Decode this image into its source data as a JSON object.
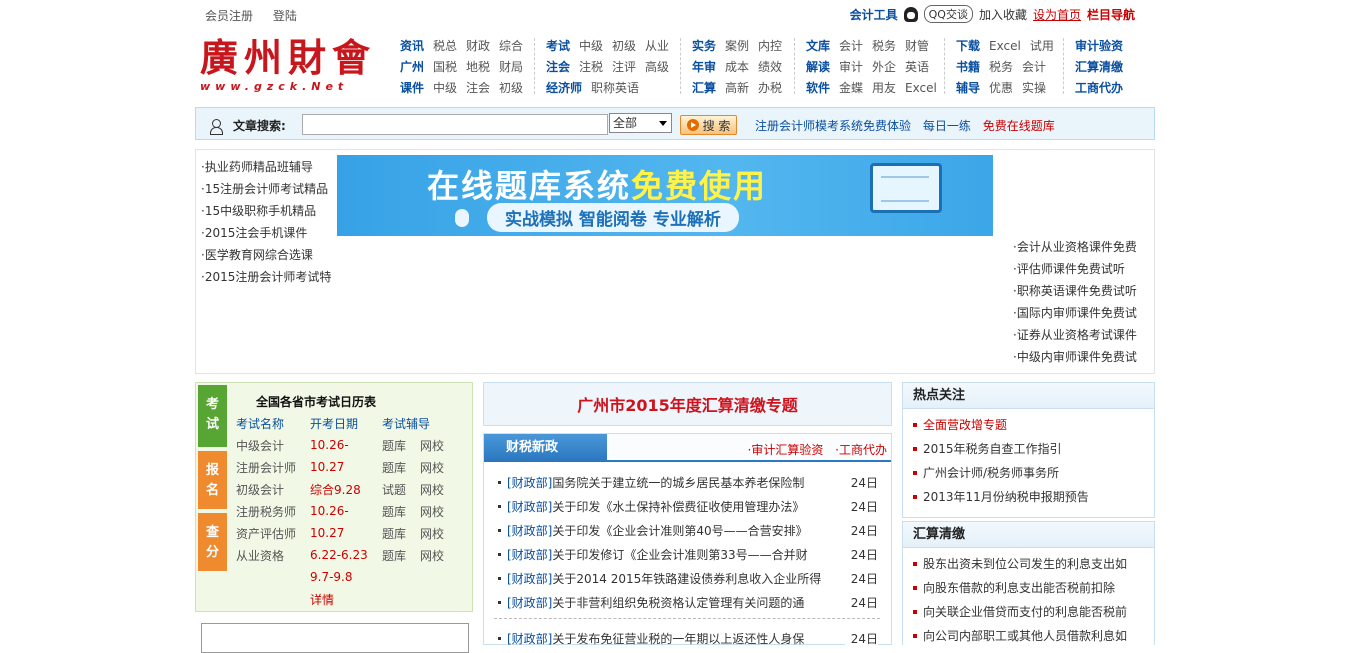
{
  "topbar": {
    "register": "会员注册",
    "login": "登陆",
    "tools": "会计工具",
    "qq": "QQ交谈",
    "favorite": "加入收藏",
    "set_home": "设为首页",
    "nav": "栏目导航"
  },
  "logo": {
    "cn": "廣州財會",
    "en": "www.gzck.Net"
  },
  "nav_groups": [
    {
      "rows": [
        [
          "资讯",
          "税总",
          "财政",
          "综合"
        ],
        [
          "广州",
          "国税",
          "地税",
          "财局"
        ],
        [
          "课件",
          "中级",
          "注会",
          "初级"
        ]
      ]
    },
    {
      "rows": [
        [
          "考试",
          "中级",
          "初级",
          "从业"
        ],
        [
          "注会",
          "注税",
          "注评",
          "高级"
        ],
        [
          "经济师",
          "职称英语"
        ]
      ]
    },
    {
      "rows": [
        [
          "实务",
          "案例",
          "内控"
        ],
        [
          "年审",
          "成本",
          "绩效"
        ],
        [
          "汇算",
          "高新",
          "办税"
        ]
      ]
    },
    {
      "rows": [
        [
          "文库",
          "会计",
          "税务",
          "财管"
        ],
        [
          "解读",
          "审计",
          "外企",
          "英语"
        ],
        [
          "软件",
          "金蝶",
          "用友",
          "Excel"
        ]
      ]
    },
    {
      "rows": [
        [
          "下载",
          "Excel",
          "试用"
        ],
        [
          "书籍",
          "税务",
          "会计"
        ],
        [
          "辅导",
          "优惠",
          "实操"
        ]
      ]
    },
    {
      "rows": [
        [
          "审计验资"
        ],
        [
          "汇算清缴"
        ],
        [
          "工商代办"
        ]
      ]
    }
  ],
  "search": {
    "label": "文章搜索:",
    "placeholder": "",
    "select_value": "全部",
    "button": "搜 索",
    "links": [
      "注册会计师模考系统免费体验",
      "每日一练",
      "免费在线题库"
    ]
  },
  "promo_left": [
    "·执业药师精品班辅导",
    "·15注册会计师考试精品",
    "·15中级职称手机精品",
    "·2015注会手机课件",
    "·医学教育网综合选课",
    "·2015注册会计师考试特"
  ],
  "banner": {
    "title_a": "在线题库系统",
    "title_b": "免费使用",
    "subtitle": "实战模拟 智能阅卷 专业解析",
    "screen_label": "模拟考试"
  },
  "promo_right": [
    "·会计从业资格课件免费",
    "·评估师课件免费试听",
    "·职称英语课件免费试听",
    "·国际内审师课件免费试",
    "·证券从业资格考试课件",
    "·中级内审师课件免费试"
  ],
  "calendar": {
    "tabs": [
      "考试",
      "报名",
      "查分"
    ],
    "title": "全国各省市考试日历表",
    "headers": [
      "考试名称",
      "开考日期",
      "考试辅导"
    ],
    "rows": [
      [
        "中级会计",
        "10.26-",
        "题库",
        "网校"
      ],
      [
        "注册会计师",
        "10.27",
        "题库",
        "网校"
      ],
      [
        "初级会计",
        "综合9.28",
        "试题",
        "网校"
      ],
      [
        "注册税务师",
        "10.26-",
        "题库",
        "网校"
      ],
      [
        "资产评估师",
        "10.27",
        "题库",
        "网校"
      ],
      [
        "从业资格",
        "6.22-6.23",
        "题库",
        "网校"
      ],
      [
        "",
        "9.7-9.8",
        "",
        ""
      ],
      [
        "",
        "详情",
        "",
        ""
      ]
    ]
  },
  "special_topic": "广州市2015年度汇算清缴专题",
  "news": {
    "tab": "财税新政",
    "tab_links": [
      "·审计汇算验资",
      "·工商代办"
    ],
    "items": [
      {
        "src": "[财政部]",
        "title": "国务院关于建立统一的城乡居民基本养老保险制",
        "day": "24日"
      },
      {
        "src": "[财政部]",
        "title": "关于印发《水土保持补偿费征收使用管理办法》",
        "day": "24日"
      },
      {
        "src": "[财政部]",
        "title": "关于印发《企业会计准则第40号——合营安排》",
        "day": "24日"
      },
      {
        "src": "[财政部]",
        "title": "关于印发修订《企业会计准则第33号——合并财",
        "day": "24日"
      },
      {
        "src": "[财政部]",
        "title": "关于2014 2015年铁路建设债券利息收入企业所得",
        "day": "24日"
      },
      {
        "src": "[财政部]",
        "title": "关于非营利组织免税资格认定管理有关问题的通",
        "day": "24日"
      },
      {
        "src": "[财政部]",
        "title": "关于发布免征营业税的一年期以上返还性人身保",
        "day": "24日"
      }
    ]
  },
  "hot": {
    "title": "热点关注",
    "items": [
      "全面营改增专题",
      "2015年税务自查工作指引",
      "广州会计师/税务师事务所",
      "2013年11月份纳税申报期预告"
    ]
  },
  "settle": {
    "title": "汇算清缴",
    "items": [
      "股东出资未到位公司发生的利息支出如",
      "向股东借款的利息支出能否税前扣除",
      "向关联企业借贷而支付的利息能否税前",
      "向公司内部职工或其他人员借款利息如"
    ]
  },
  "colors": {
    "brand_red": "#c8161d",
    "link_blue": "#0a4fa0",
    "tab_blue": "#2a76bd"
  }
}
